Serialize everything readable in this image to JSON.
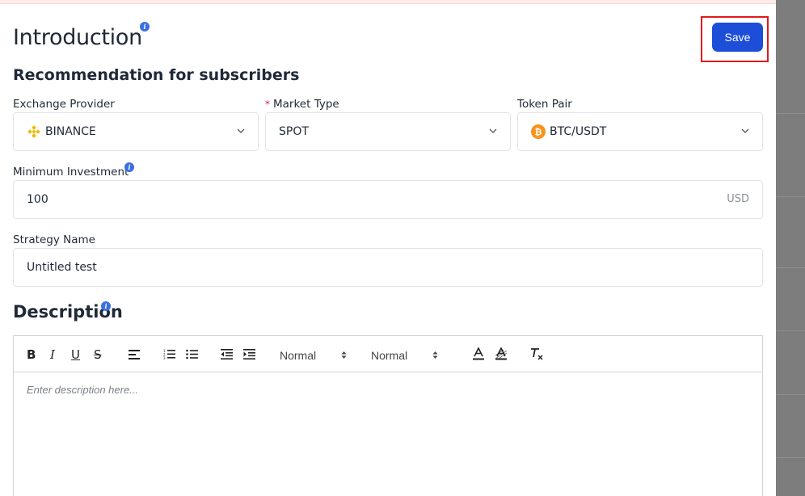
{
  "header": {
    "title": "Introduction",
    "info_icon": "i",
    "save_label": "Save"
  },
  "subtitle": "Recommendation for subscribers",
  "fields": {
    "exchange_provider": {
      "label": "Exchange Provider",
      "value": "BINANCE",
      "icon": "binance-icon"
    },
    "market_type": {
      "required_mark": "*",
      "label": "Market Type",
      "value": "SPOT"
    },
    "token_pair": {
      "label": "Token Pair",
      "value": "BTC/USDT",
      "icon": "bitcoin-icon",
      "icon_glyph": "₿"
    },
    "minimum_investment": {
      "label": "Minimum Investment",
      "value": "100",
      "unit": "USD"
    },
    "strategy_name": {
      "label": "Strategy Name",
      "value": "Untitled test"
    }
  },
  "description": {
    "title": "Description",
    "toolbar": {
      "font_size_select": "Normal",
      "heading_select": "Normal"
    },
    "placeholder": "Enter description here..."
  },
  "colors": {
    "accent": "#1d4ed8",
    "highlight": "#e01b1b",
    "binance": "#f0b90b",
    "bitcoin": "#f7931a"
  }
}
